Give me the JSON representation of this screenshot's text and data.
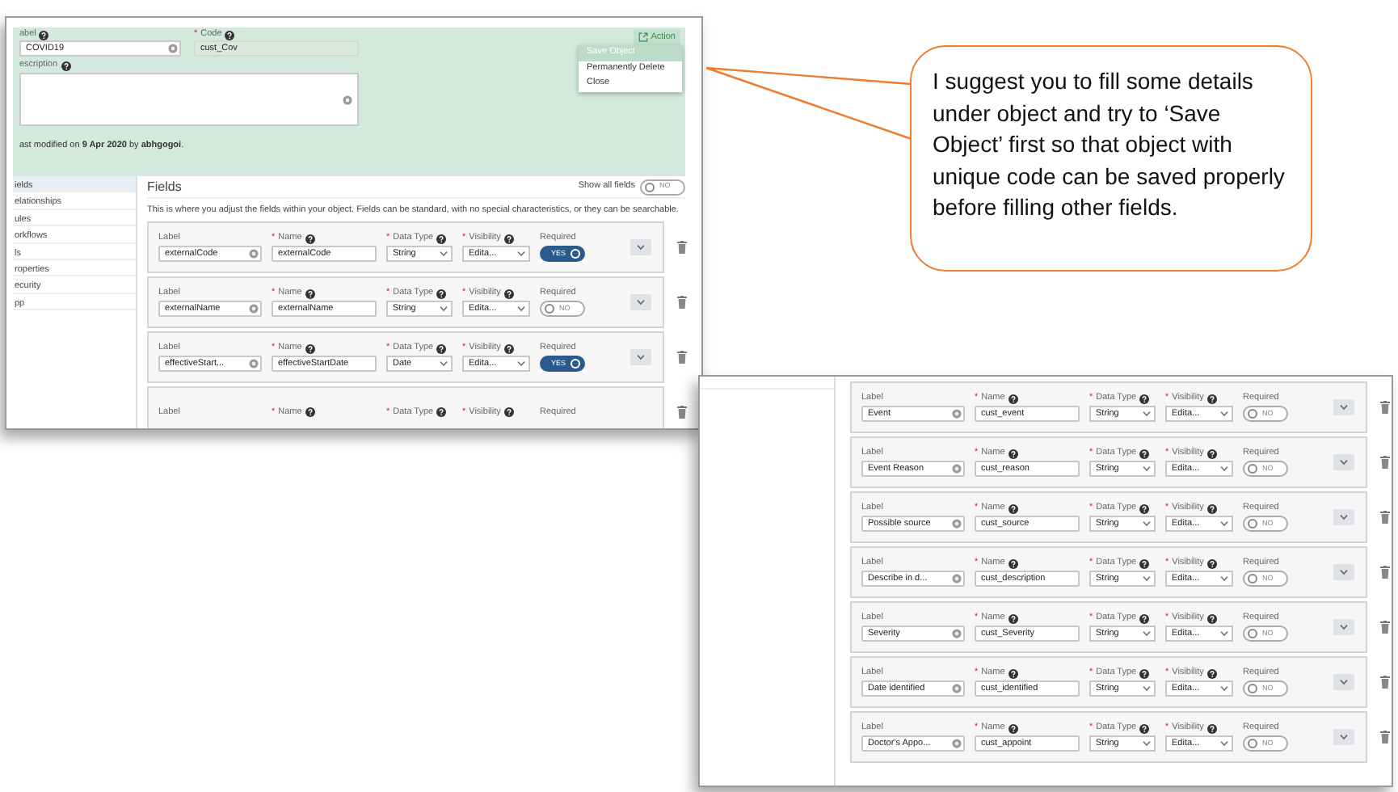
{
  "screenshot_1": {
    "object_header": {
      "label_field": {
        "text": "abel",
        "help": true,
        "value": "COVID19"
      },
      "code_field": {
        "asterisk": "*",
        "text": "Code",
        "help": true,
        "value": "cust_Cov"
      },
      "description_field": {
        "text": "escription",
        "help": true
      },
      "last_modified": "ast modified on **9 Apr 2020** by **abhgogoi**.",
      "action_button": "Action",
      "action_menu": [
        {
          "label": "Save Object",
          "selected": true
        },
        {
          "label": "Permanently Delete",
          "selected": false
        },
        {
          "label": "Close",
          "selected": false
        }
      ]
    },
    "sidebar": {
      "items": [
        {
          "label": "ields",
          "selected": true
        },
        {
          "label": "elationships",
          "selected": false
        },
        {
          "label": "ules",
          "selected": false
        },
        {
          "label": "orkflows",
          "selected": false
        },
        {
          "label": "ls",
          "selected": false
        },
        {
          "label": "roperties",
          "selected": false
        },
        {
          "label": "ecurity",
          "selected": false
        },
        {
          "label": "pp",
          "selected": false
        }
      ]
    },
    "fields_panel": {
      "title": "Fields",
      "show_all_fields": {
        "label": "Show all fields",
        "on": false,
        "text": "NO"
      },
      "description": "This is where you adjust the fields within your object. Fields can be standard, with no special characteristics, or they can be searchable.",
      "rows": [
        {
          "captions": [
            {
              "text": "Label"
            },
            {
              "asterisk": "*",
              "text": "Name",
              "help": true
            },
            {
              "asterisk": "*",
              "text": "Data Type",
              "help": true
            },
            {
              "asterisk": "*",
              "text": "Visibility",
              "help": true
            },
            {
              "text": "Required"
            }
          ],
          "label": "externalCode",
          "name": "externalCode",
          "data_type": "String",
          "visibility": "Edita...",
          "required": {
            "on": true,
            "text": "YES"
          }
        },
        {
          "captions": [
            {
              "text": "Label"
            },
            {
              "asterisk": "*",
              "text": "Name",
              "help": true
            },
            {
              "asterisk": "*",
              "text": "Data Type",
              "help": true
            },
            {
              "asterisk": "*",
              "text": "Visibility",
              "help": true
            },
            {
              "text": "Required"
            }
          ],
          "label": "externalName",
          "name": "externalName",
          "data_type": "String",
          "visibility": "Edita...",
          "required": {
            "on": false,
            "text": "NO"
          }
        },
        {
          "captions": [
            {
              "text": "Label"
            },
            {
              "asterisk": "*",
              "text": "Name",
              "help": true
            },
            {
              "asterisk": "*",
              "text": "Data Type",
              "help": true
            },
            {
              "asterisk": "*",
              "text": "Visibility",
              "help": true
            },
            {
              "text": "Required"
            }
          ],
          "label": "effectiveStart...",
          "name": "effectiveStartDate",
          "data_type": "Date",
          "visibility": "Edita...",
          "required": {
            "on": true,
            "text": "YES"
          }
        },
        {
          "captions": [
            {
              "text": "Label"
            },
            {
              "asterisk": "*",
              "text": "Name",
              "help": true
            },
            {
              "asterisk": "*",
              "text": "Data Type",
              "help": true
            },
            {
              "asterisk": "*",
              "text": "Visibility",
              "help": true
            },
            {
              "text": "Required"
            }
          ]
        }
      ]
    }
  },
  "screenshot_2": {
    "rows": [
      {
        "captions": [
          {
            "text": "Label"
          },
          {
            "asterisk": "*",
            "text": "Name",
            "help": true
          },
          {
            "asterisk": "*",
            "text": "Data Type",
            "help": true
          },
          {
            "asterisk": "*",
            "text": "Visibility",
            "help": true
          },
          {
            "text": "Required"
          }
        ],
        "label": "Event",
        "name": "cust_event",
        "data_type": "String",
        "visibility": "Edita...",
        "required": {
          "on": false,
          "text": "NO"
        }
      },
      {
        "captions": [
          {
            "text": "Label"
          },
          {
            "asterisk": "*",
            "text": "Name",
            "help": true
          },
          {
            "asterisk": "*",
            "text": "Data Type",
            "help": true
          },
          {
            "asterisk": "*",
            "text": "Visibility",
            "help": true
          },
          {
            "text": "Required"
          }
        ],
        "label": "Event Reason",
        "name": "cust_reason",
        "data_type": "String",
        "visibility": "Edita...",
        "required": {
          "on": false,
          "text": "NO"
        }
      },
      {
        "captions": [
          {
            "text": "Label"
          },
          {
            "asterisk": "*",
            "text": "Name",
            "help": true
          },
          {
            "asterisk": "*",
            "text": "Data Type",
            "help": true
          },
          {
            "asterisk": "*",
            "text": "Visibility",
            "help": true
          },
          {
            "text": "Required"
          }
        ],
        "label": "Possible source",
        "name": "cust_source",
        "data_type": "String",
        "visibility": "Edita...",
        "required": {
          "on": false,
          "text": "NO"
        }
      },
      {
        "captions": [
          {
            "text": "Label"
          },
          {
            "asterisk": "*",
            "text": "Name",
            "help": true
          },
          {
            "asterisk": "*",
            "text": "Data Type",
            "help": true
          },
          {
            "asterisk": "*",
            "text": "Visibility",
            "help": true
          },
          {
            "text": "Required"
          }
        ],
        "label": "Describe in d...",
        "name": "cust_description",
        "data_type": "String",
        "visibility": "Edita...",
        "required": {
          "on": false,
          "text": "NO"
        }
      },
      {
        "captions": [
          {
            "text": "Label"
          },
          {
            "asterisk": "*",
            "text": "Name",
            "help": true
          },
          {
            "asterisk": "*",
            "text": "Data Type",
            "help": true
          },
          {
            "asterisk": "*",
            "text": "Visibility",
            "help": true
          },
          {
            "text": "Required"
          }
        ],
        "label": "Severity",
        "name": "cust_Severity",
        "data_type": "String",
        "visibility": "Edita...",
        "required": {
          "on": false,
          "text": "NO"
        }
      },
      {
        "captions": [
          {
            "text": "Label"
          },
          {
            "asterisk": "*",
            "text": "Name",
            "help": true
          },
          {
            "asterisk": "*",
            "text": "Data Type",
            "help": true
          },
          {
            "asterisk": "*",
            "text": "Visibility",
            "help": true
          },
          {
            "text": "Required"
          }
        ],
        "label": "Date identified",
        "name": "cust_identified",
        "data_type": "String",
        "visibility": "Edita...",
        "required": {
          "on": false,
          "text": "NO"
        }
      },
      {
        "captions": [
          {
            "text": "Label"
          },
          {
            "asterisk": "*",
            "text": "Name",
            "help": true
          },
          {
            "asterisk": "*",
            "text": "Data Type",
            "help": true
          },
          {
            "asterisk": "*",
            "text": "Visibility",
            "help": true
          },
          {
            "text": "Required"
          }
        ],
        "label": "Doctor's Appo...",
        "name": "cust_appoint",
        "data_type": "String",
        "visibility": "Edita...",
        "required": {
          "on": false,
          "text": "NO"
        }
      }
    ]
  },
  "callout": {
    "text": "I suggest you to fill some details under object and try to ‘Save Object’ first so that object with unique code can be saved properly before filling other fields."
  }
}
